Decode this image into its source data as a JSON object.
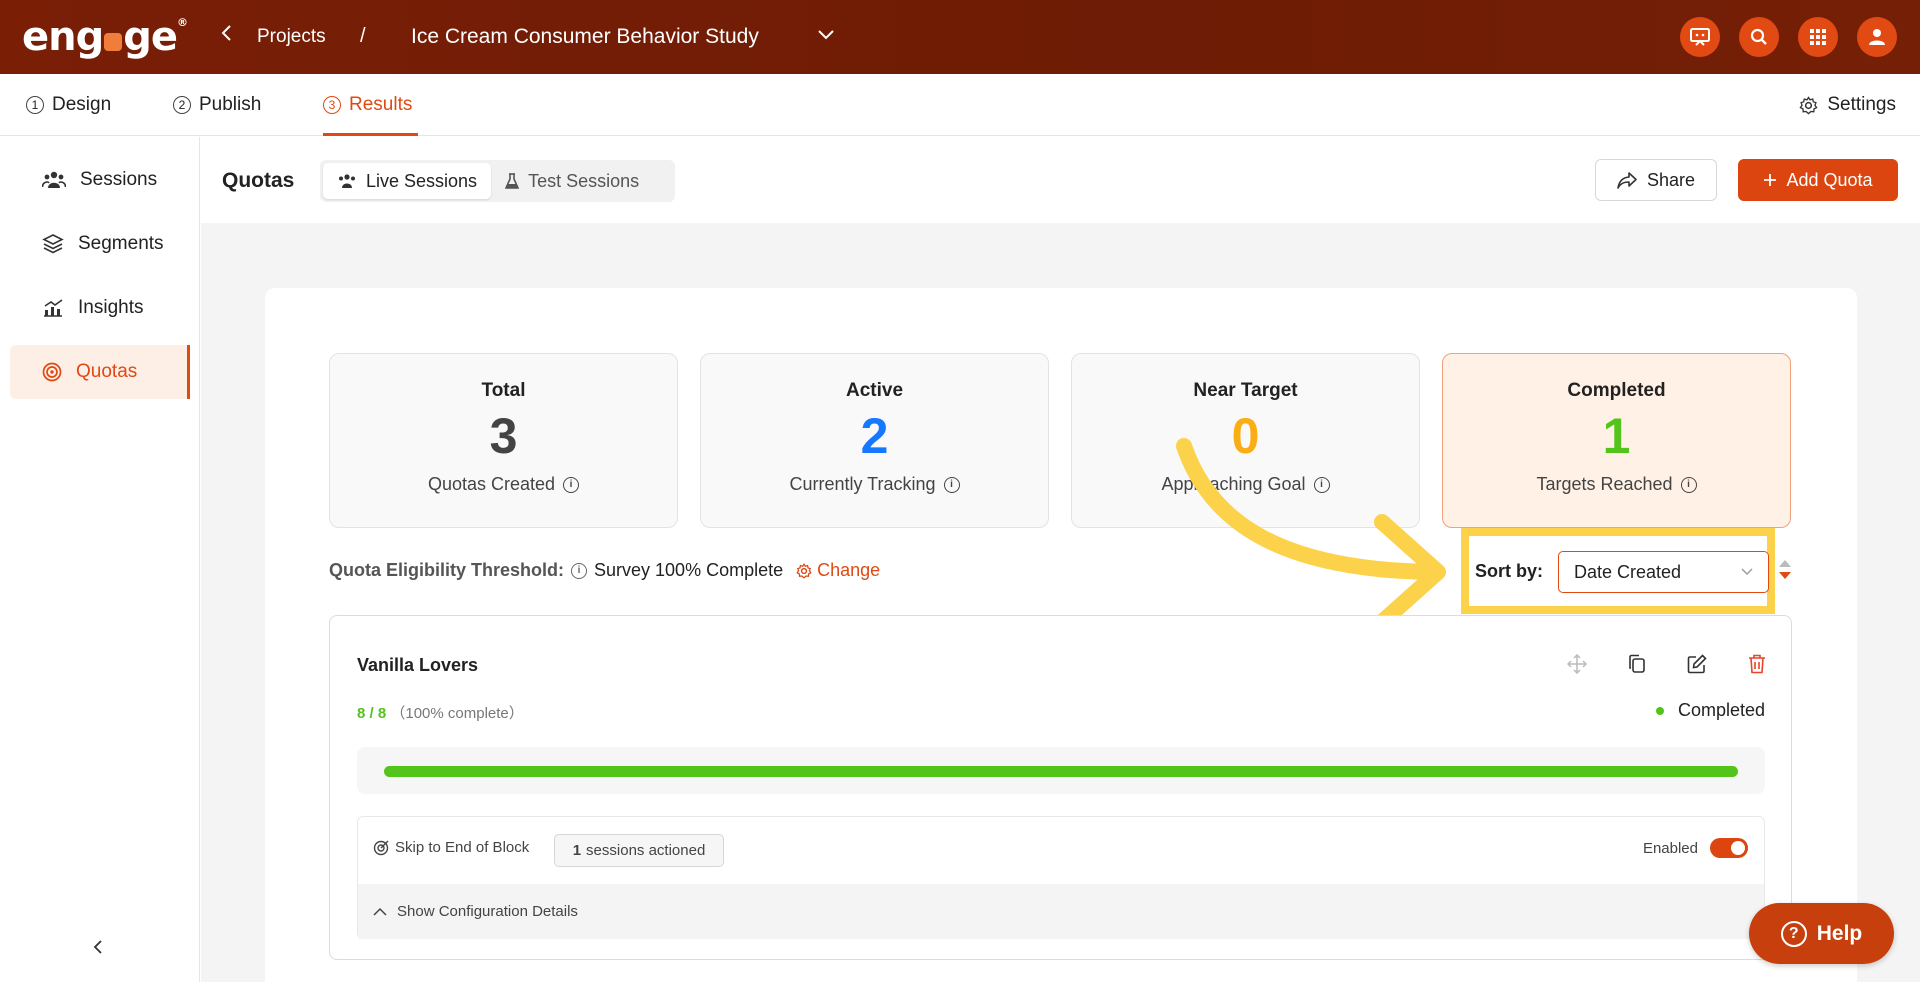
{
  "app": {
    "logo_text": "eng",
    "logo_text_end": "ge",
    "logo_reg": "®"
  },
  "breadcrumb": {
    "back_label": "Projects",
    "separator": "/",
    "project_title": "Ice Cream Consumer Behavior Study"
  },
  "top_icons": [
    "presentation-icon",
    "search-icon",
    "apps-grid-icon",
    "user-icon"
  ],
  "steps": [
    {
      "num": "1",
      "label": "Design"
    },
    {
      "num": "2",
      "label": "Publish"
    },
    {
      "num": "3",
      "label": "Results"
    }
  ],
  "settings_label": "Settings",
  "sidebar": {
    "items": [
      {
        "label": "Sessions",
        "icon": "users-icon"
      },
      {
        "label": "Segments",
        "icon": "layers-icon"
      },
      {
        "label": "Insights",
        "icon": "chart-icon"
      },
      {
        "label": "Quotas",
        "icon": "target-icon"
      }
    ],
    "collapse_glyph": "<"
  },
  "header": {
    "title": "Quotas",
    "segments": [
      "Live Sessions",
      "Test Sessions"
    ],
    "share_label": "Share",
    "add_label": "Add Quota"
  },
  "stats": [
    {
      "label": "Total",
      "value": "3",
      "sub": "Quotas Created",
      "color": "#444444"
    },
    {
      "label": "Active",
      "value": "2",
      "sub": "Currently Tracking",
      "color": "#1677ff"
    },
    {
      "label": "Near Target",
      "value": "0",
      "sub": "Approaching Goal",
      "color": "#faad14"
    },
    {
      "label": "Completed",
      "value": "1",
      "sub": "Targets Reached",
      "color": "#52c41a"
    }
  ],
  "threshold": {
    "label": "Quota Eligibility Threshold:",
    "value": "Survey 100% Complete",
    "change_label": "Change"
  },
  "sort": {
    "label": "Sort by:",
    "value": "Date Created"
  },
  "quota_card": {
    "title": "Vanilla Lovers",
    "progress_count": "8 / 8",
    "progress_pct_text": "（100% complete）",
    "progress_fraction": 1.0,
    "status": "Completed",
    "action_label": "Skip to End of Block",
    "sessions_count": "1",
    "sessions_label": "sessions actioned",
    "enabled_label": "Enabled",
    "config_label": "Show Configuration Details"
  },
  "help_label": "Help",
  "colors": {
    "brand": "#dc4510",
    "topbar": "#721d05",
    "highlight": "#fbd24a",
    "success": "#52c41a"
  }
}
